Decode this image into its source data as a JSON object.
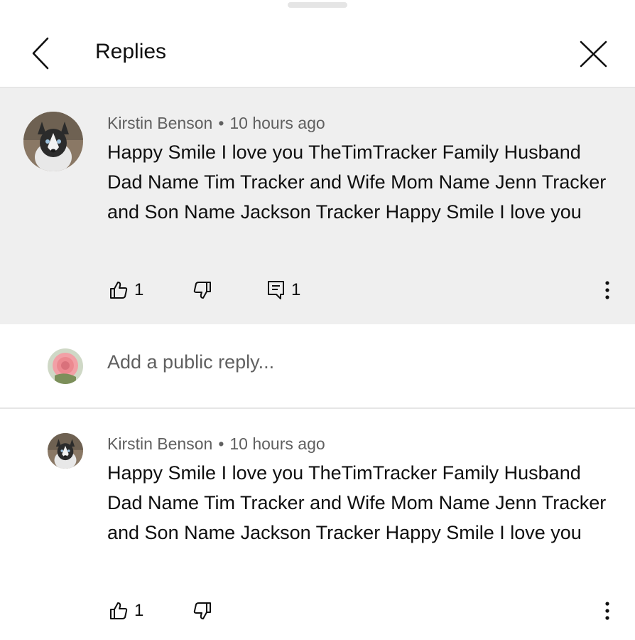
{
  "header": {
    "title": "Replies",
    "back_icon": "chevron-left-icon",
    "close_icon": "close-icon"
  },
  "parent_comment": {
    "author": "Kirstin Benson",
    "separator": "•",
    "time": "10 hours ago",
    "text": "Happy Smile I love you TheTimTracker Family Husband Dad Name Tim Tracker and Wife Mom Name Jenn Tracker and Son Name Jackson Tracker Happy Smile I love you",
    "likes": "1",
    "replies": "1",
    "avatar_icon": "husky-dog-avatar"
  },
  "reply_box": {
    "placeholder": "Add a public reply...",
    "avatar_icon": "rose-flower-avatar"
  },
  "reply_comment": {
    "author": "Kirstin Benson",
    "separator": "•",
    "time": "10 hours ago",
    "text": "Happy Smile I love you TheTimTracker Family Husband Dad Name Tim Tracker and Wife Mom Name Jenn Tracker and Son Name Jackson Tracker Happy Smile I love you",
    "likes": "1",
    "avatar_icon": "husky-dog-avatar"
  },
  "colors": {
    "highlight_bg": "#efefef",
    "meta_text": "#606060",
    "divider": "#e6e6e6"
  }
}
